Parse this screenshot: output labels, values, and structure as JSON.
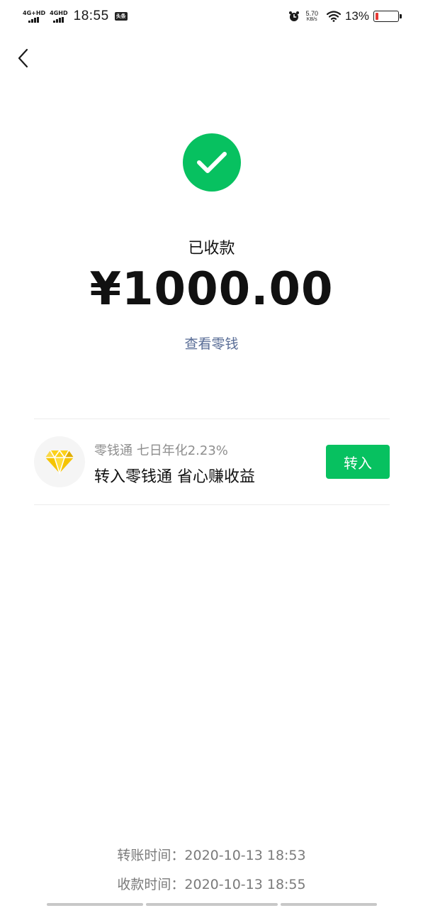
{
  "status_bar": {
    "network1": "4G+HD",
    "network2": "4GHD",
    "time": "18:55",
    "app_badge": "头条",
    "speed_value": "5.70",
    "speed_unit": "KB/s",
    "battery_percent": "13%",
    "battery_level": 0.13,
    "battery_color": "#e53935",
    "icons": [
      "alarm-icon",
      "wifi-icon",
      "battery-icon"
    ]
  },
  "header": {
    "back_icon": "chevron-left-icon"
  },
  "receipt": {
    "status_icon": "check-circle-icon",
    "status_text": "已收款",
    "amount": "¥1000.00",
    "view_change_link": "查看零钱"
  },
  "promo": {
    "logo_icon": "diamond-icon",
    "subtitle": "零钱通 七日年化2.23%",
    "title": "转入零钱通 省心赚收益",
    "button_label": "转入"
  },
  "times": {
    "transfer": "转账时间：2020-10-13 18:53",
    "receive": "收款时间：2020-10-13 18:55"
  },
  "colors": {
    "accent_green": "#07c160",
    "link_blue": "#576b95",
    "diamond_yellow": "#f5c400"
  }
}
